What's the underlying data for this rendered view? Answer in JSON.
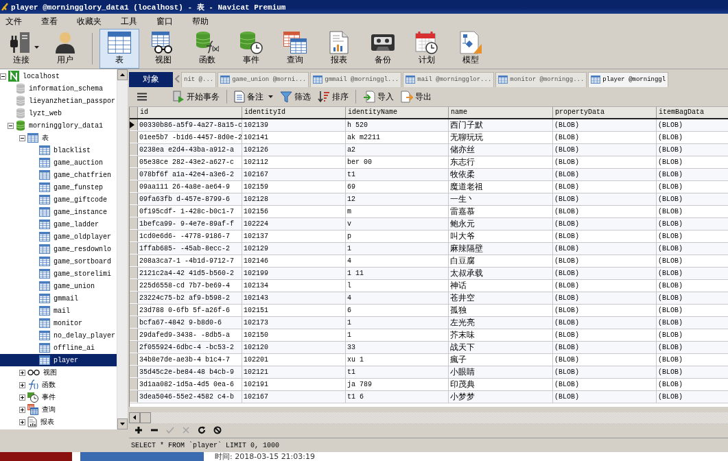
{
  "window": {
    "title": "player @morningglory_data1 (localhost) - 表 - Navicat Premium"
  },
  "menu": [
    "文件",
    "查看",
    "收藏夹",
    "工具",
    "窗口",
    "帮助"
  ],
  "toolbar": [
    {
      "label": "连接",
      "kind": "connect",
      "selected": false,
      "dropdown": true
    },
    {
      "label": "用户",
      "kind": "user",
      "selected": false,
      "dropdown": false
    },
    {
      "label": "表",
      "kind": "table",
      "selected": true,
      "dropdown": false
    },
    {
      "label": "视图",
      "kind": "view",
      "selected": false,
      "dropdown": false
    },
    {
      "label": "函数",
      "kind": "function",
      "selected": false,
      "dropdown": false
    },
    {
      "label": "事件",
      "kind": "event",
      "selected": false,
      "dropdown": false
    },
    {
      "label": "查询",
      "kind": "query",
      "selected": false,
      "dropdown": false
    },
    {
      "label": "报表",
      "kind": "report",
      "selected": false,
      "dropdown": false
    },
    {
      "label": "备份",
      "kind": "backup",
      "selected": false,
      "dropdown": false
    },
    {
      "label": "计划",
      "kind": "schedule",
      "selected": false,
      "dropdown": false
    },
    {
      "label": "模型",
      "kind": "model",
      "selected": false,
      "dropdown": false
    }
  ],
  "tree": [
    {
      "label": "localhost",
      "kind": "server",
      "expanded": true,
      "selected": false,
      "children": [
        {
          "label": "information_schema",
          "kind": "db-closed",
          "selected": false
        },
        {
          "label": "lieyanzhetian_passpor",
          "kind": "db-closed",
          "selected": false
        },
        {
          "label": "lyzt_web",
          "kind": "db-closed",
          "selected": false
        },
        {
          "label": "morningglory_data1",
          "kind": "db",
          "expanded": true,
          "selected": false,
          "children": [
            {
              "label": "表",
              "kind": "table",
              "expanded": true,
              "selected": false,
              "children": [
                {
                  "label": "blacklist",
                  "kind": "table",
                  "selected": false
                },
                {
                  "label": "game_auction",
                  "kind": "table",
                  "selected": false
                },
                {
                  "label": "game_chatfrien",
                  "kind": "table",
                  "selected": false
                },
                {
                  "label": "game_funstep",
                  "kind": "table",
                  "selected": false
                },
                {
                  "label": "game_giftcode",
                  "kind": "table",
                  "selected": false
                },
                {
                  "label": "game_instance",
                  "kind": "table",
                  "selected": false
                },
                {
                  "label": "game_ladder",
                  "kind": "table",
                  "selected": false
                },
                {
                  "label": "game_oldplayer",
                  "kind": "table",
                  "selected": false
                },
                {
                  "label": "game_resdownlo",
                  "kind": "table",
                  "selected": false
                },
                {
                  "label": "game_sortboard",
                  "kind": "table",
                  "selected": false
                },
                {
                  "label": "game_storelimi",
                  "kind": "table",
                  "selected": false
                },
                {
                  "label": "game_union",
                  "kind": "table",
                  "selected": false
                },
                {
                  "label": "gmmail",
                  "kind": "table",
                  "selected": false
                },
                {
                  "label": "mail",
                  "kind": "table",
                  "selected": false
                },
                {
                  "label": "monitor",
                  "kind": "table",
                  "selected": false
                },
                {
                  "label": "no_delay_player",
                  "kind": "table",
                  "selected": false
                },
                {
                  "label": "offline_ai",
                  "kind": "table",
                  "selected": false
                },
                {
                  "label": "player",
                  "kind": "table",
                  "selected": true
                }
              ]
            },
            {
              "label": "视图",
              "kind": "view",
              "expanded": false,
              "selected": false
            },
            {
              "label": "函数",
              "kind": "function",
              "expanded": false,
              "selected": false
            },
            {
              "label": "事件",
              "kind": "event",
              "expanded": false,
              "selected": false
            },
            {
              "label": "查询",
              "kind": "query",
              "expanded": false,
              "selected": false
            },
            {
              "label": "报表",
              "kind": "report",
              "expanded": false,
              "selected": false
            }
          ]
        }
      ]
    }
  ],
  "object_tab": {
    "label": "对象"
  },
  "tabs": [
    {
      "label": "nit @...",
      "selected": false
    },
    {
      "label": "game_union @morni...",
      "selected": false
    },
    {
      "label": "gmmail @morninggl...",
      "selected": false
    },
    {
      "label": "mail @morningglor...",
      "selected": false
    },
    {
      "label": "monitor @morningg...",
      "selected": false
    },
    {
      "label": "player @morninggl",
      "selected": true
    }
  ],
  "grid_toolbar": [
    {
      "label": "开始事务",
      "kind": "transaction",
      "dropdown": false
    },
    {
      "label": "备注",
      "kind": "memo",
      "dropdown": true
    },
    {
      "label": "筛选",
      "kind": "filter",
      "dropdown": false
    },
    {
      "label": "排序",
      "kind": "sort",
      "dropdown": false
    },
    {
      "label": "导入",
      "kind": "import",
      "dropdown": false
    },
    {
      "label": "导出",
      "kind": "export",
      "dropdown": false
    }
  ],
  "table": {
    "columns": [
      "id",
      "identityId",
      "identityName",
      "name",
      "propertyData",
      "itemBagData"
    ],
    "rows": [
      {
        "current": true,
        "cells": [
          "00330b86-a5f9-4a27-8a15-c",
          "102139",
          "h 520",
          "西门子默",
          "(BLOB)",
          "(BLOB)"
        ]
      },
      {
        "current": false,
        "cells": [
          "01ee5b7 -b1d6-4457-8d0e-2",
          "102141",
          "ak m2211",
          "无聊玩玩",
          "(BLOB)",
          "(BLOB)"
        ]
      },
      {
        "current": false,
        "cells": [
          "0238ea e2d4-43ba-a912-a",
          "102126",
          "a2",
          "储亦丝",
          "(BLOB)",
          "(BLOB)"
        ]
      },
      {
        "current": false,
        "cells": [
          "05e38ce 282-43e2-a627-c",
          "102112",
          "ber 00",
          "东志行",
          "(BLOB)",
          "(BLOB)"
        ]
      },
      {
        "current": false,
        "cells": [
          "078bf6f a1a-42e4-a3e6-2",
          "102167",
          "t1",
          "牧依柔",
          "(BLOB)",
          "(BLOB)"
        ]
      },
      {
        "current": false,
        "cells": [
          "09aa111 26-4a8e-ae64-9",
          "102159",
          "69",
          "魔道老祖",
          "(BLOB)",
          "(BLOB)"
        ]
      },
      {
        "current": false,
        "cells": [
          "09fa63fb d-457e-8799-6",
          "102128",
          "12",
          "一生丶",
          "(BLOB)",
          "(BLOB)"
        ]
      },
      {
        "current": false,
        "cells": [
          "0f195cdf- 1-428c-b0c1-7",
          "102156",
          "m",
          "雷嘉慕",
          "(BLOB)",
          "(BLOB)"
        ]
      },
      {
        "current": false,
        "cells": [
          "1befca99- 9-4e7e-89af-f",
          "102224",
          "v",
          "鲍永元",
          "(BLOB)",
          "(BLOB)"
        ]
      },
      {
        "current": false,
        "cells": [
          "1cd0e6d6- -4778-9186-7",
          "102137",
          "p",
          "叫大爷",
          "(BLOB)",
          "(BLOB)"
        ]
      },
      {
        "current": false,
        "cells": [
          "1ffab685- -45ab-8ecc-2",
          "102129",
          "1",
          "麻辣隔壁",
          "(BLOB)",
          "(BLOB)"
        ]
      },
      {
        "current": false,
        "cells": [
          "208a3ca7-1 -4b1d-9712-7",
          "102146",
          "4",
          "白豆腐",
          "(BLOB)",
          "(BLOB)"
        ]
      },
      {
        "current": false,
        "cells": [
          "2121c2a4-42 41d5-b560-2",
          "102199",
          "1 11",
          "太叔承载",
          "(BLOB)",
          "(BLOB)"
        ]
      },
      {
        "current": false,
        "cells": [
          "225d6558-cd 7b7-be69-4",
          "102134",
          "l",
          "神话",
          "(BLOB)",
          "(BLOB)"
        ]
      },
      {
        "current": false,
        "cells": [
          "23224c75-b2 af9-b598-2",
          "102143",
          "4",
          "苍井空",
          "(BLOB)",
          "(BLOB)"
        ]
      },
      {
        "current": false,
        "cells": [
          "23d788 0-6fb 5f-a26f-6",
          "102151",
          "6",
          "孤独",
          "(BLOB)",
          "(BLOB)"
        ]
      },
      {
        "current": false,
        "cells": [
          "bcfa67-4842 9-b8d0-6",
          "102173",
          "1",
          "左光亮",
          "(BLOB)",
          "(BLOB)"
        ]
      },
      {
        "current": false,
        "cells": [
          "29dafed9-3438- -8db5-a",
          "102150",
          "1",
          "芥末味",
          "(BLOB)",
          "(BLOB)"
        ]
      },
      {
        "current": false,
        "cells": [
          "2f055924-6dbc-4 -bc53-2",
          "102120",
          "33",
          "战天下",
          "(BLOB)",
          "(BLOB)"
        ]
      },
      {
        "current": false,
        "cells": [
          "34b8e7de-ae3b-4 b1c4-7",
          "102201",
          "xu 1",
          "瘋子",
          "(BLOB)",
          "(BLOB)"
        ]
      },
      {
        "current": false,
        "cells": [
          "35d45c2e-be84-48 b4cb-9",
          "102121",
          "t1",
          "小眼睛",
          "(BLOB)",
          "(BLOB)"
        ]
      },
      {
        "current": false,
        "cells": [
          "3d1aa082-1d5a-4d5 0ea-6",
          "102191",
          "ja 789",
          "印茂典",
          "(BLOB)",
          "(BLOB)"
        ]
      },
      {
        "current": false,
        "cells": [
          "3dea5046-55e2-4582 c4-b",
          "102167",
          "t1 6",
          "小梦梦",
          "(BLOB)",
          "(BLOB)"
        ]
      }
    ]
  },
  "record_tools": [
    {
      "kind": "add",
      "disabled": false
    },
    {
      "kind": "delete",
      "disabled": false
    },
    {
      "kind": "apply",
      "disabled": true
    },
    {
      "kind": "discard",
      "disabled": true
    },
    {
      "kind": "refresh",
      "disabled": false
    },
    {
      "kind": "stop",
      "disabled": false
    }
  ],
  "status_bar": {
    "sql": "SELECT * FROM `player` LIMIT 0, 1000"
  },
  "taskbar": {
    "clock": "时间: 2018-03-15 21:03:19"
  }
}
